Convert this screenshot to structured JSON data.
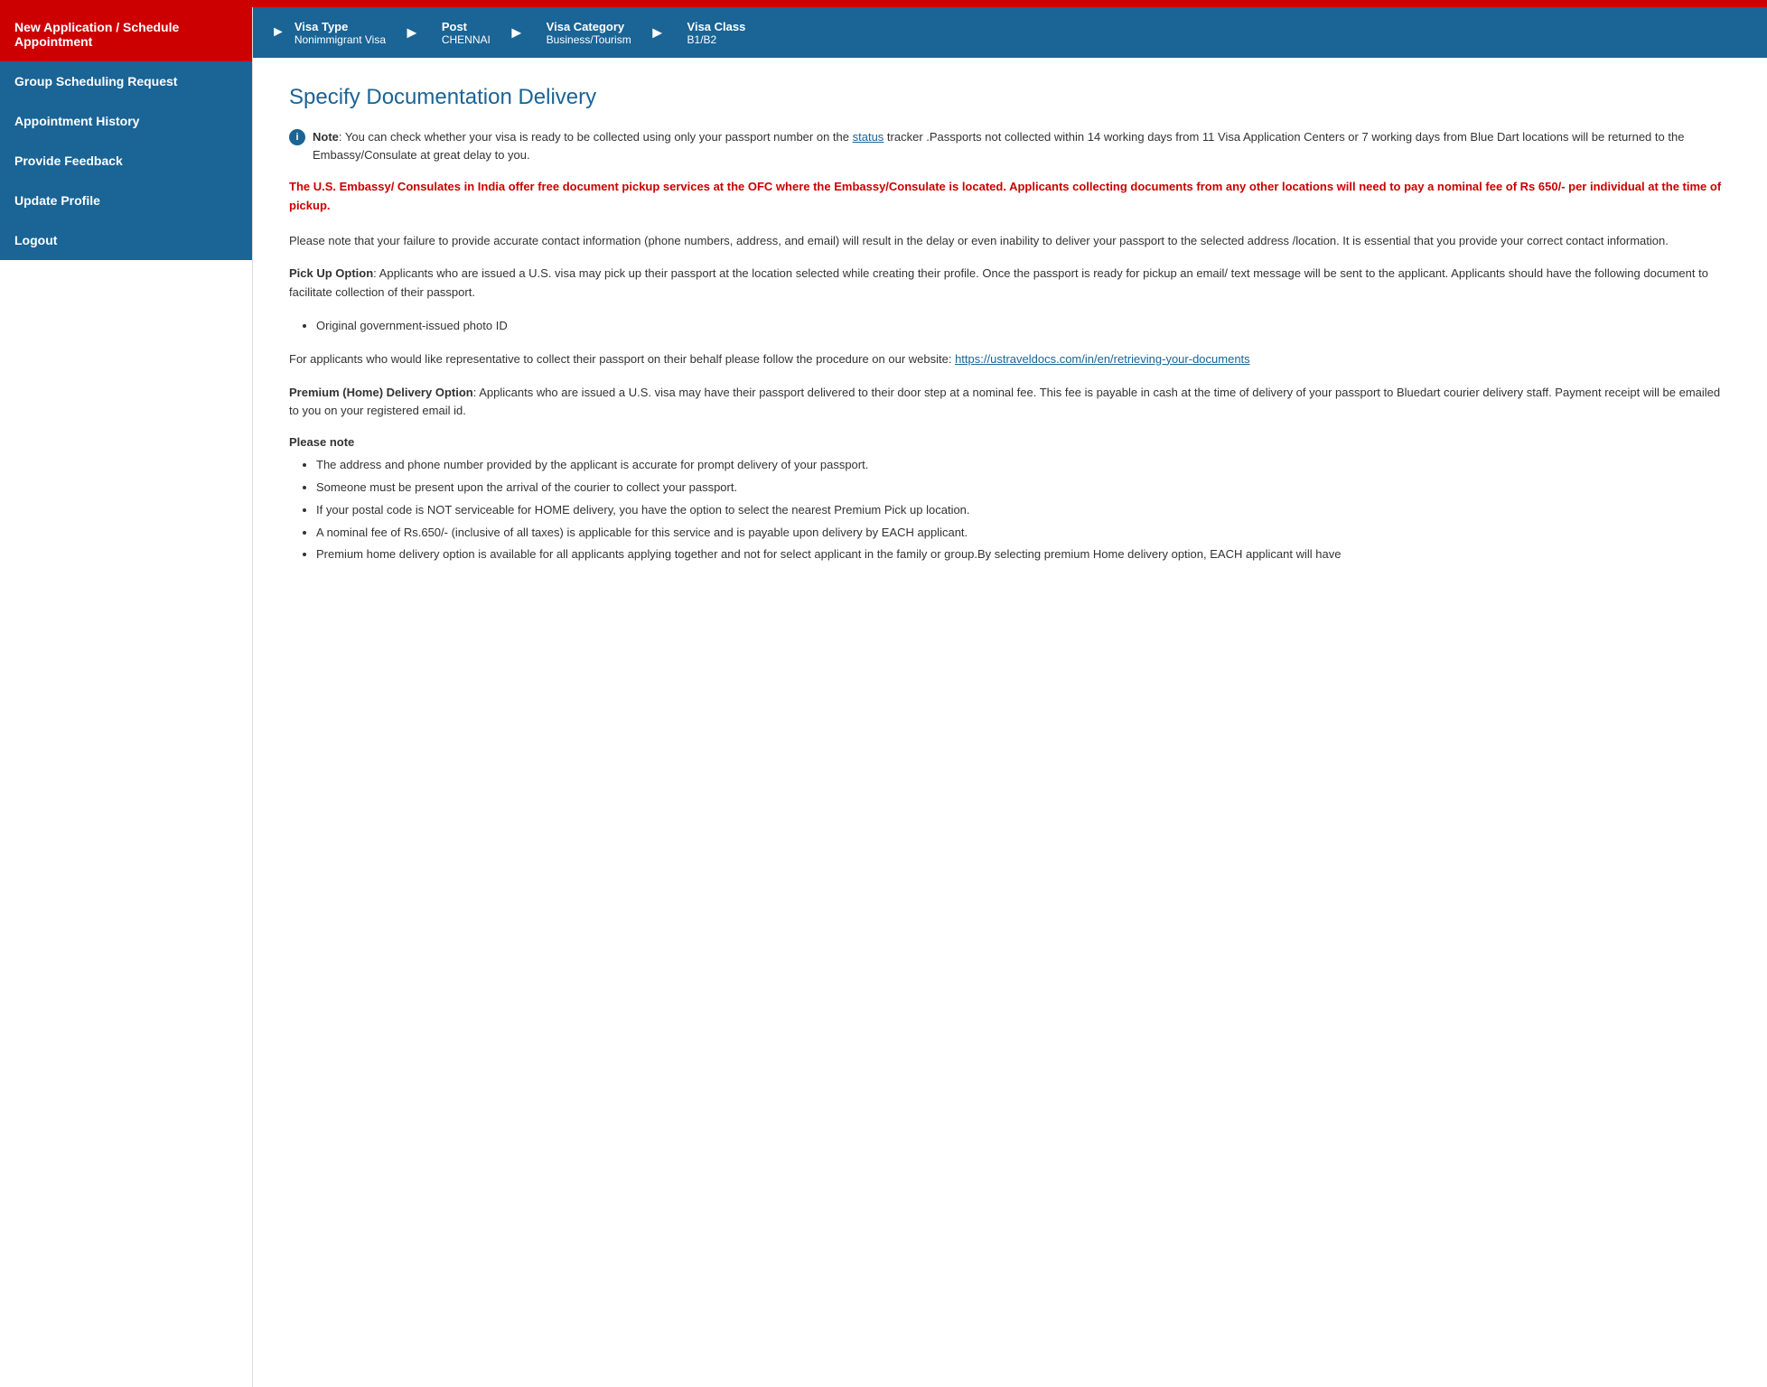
{
  "topbar": {
    "color": "#cc0000"
  },
  "sidebar": {
    "items": [
      {
        "id": "new-application",
        "label": "New Application / Schedule Appointment",
        "state": "active"
      },
      {
        "id": "group-scheduling",
        "label": "Group Scheduling Request",
        "state": "secondary"
      },
      {
        "id": "appointment-history",
        "label": "Appointment History",
        "state": "secondary"
      },
      {
        "id": "provide-feedback",
        "label": "Provide Feedback",
        "state": "secondary"
      },
      {
        "id": "update-profile",
        "label": "Update Profile",
        "state": "secondary"
      },
      {
        "id": "logout",
        "label": "Logout",
        "state": "secondary"
      }
    ]
  },
  "breadcrumb": {
    "steps": [
      {
        "label": "Visa Type",
        "value": "Nonimmigrant Visa"
      },
      {
        "label": "Post",
        "value": "CHENNAI"
      },
      {
        "label": "Visa Category",
        "value": "Business/Tourism"
      },
      {
        "label": "Visa Class",
        "value": "B1/B2"
      }
    ]
  },
  "content": {
    "page_title": "Specify Documentation Delivery",
    "info_note_prefix": "Note",
    "info_note_text": ": You can check whether your visa is ready to be collected using only your passport number on the",
    "info_note_link_text": "status",
    "info_note_link_url": "#",
    "info_note_continuation": " tracker .Passports not collected within 14 working days from 11 Visa Application Centers or 7 working days from Blue Dart locations will be returned to the Embassy/Consulate at great delay to you.",
    "warning_text": "The U.S. Embassy/ Consulates in India offer free document pickup services at the OFC where the Embassy/Consulate is located. Applicants collecting documents from any other locations will need to pay a nominal fee of Rs 650/- per individual at the time of pickup.",
    "para1": "Please note that your failure to provide accurate contact information (phone numbers, address, and email) will result in the delay or even inability to deliver your passport to the selected address /location. It is essential that you provide your correct contact information.",
    "para2_label": "Pick Up Option",
    "para2_text": ": Applicants who are issued a U.S. visa may pick up their passport at the  location selected while creating their profile.  Once the passport is ready for pickup an email/ text message will be sent to the applicant. Applicants should have the following document to facilitate collection of their passport.",
    "bullet1": "Original government-issued photo ID",
    "para3_prefix": "For applicants who would like representative to collect their passport on their behalf please follow the procedure on our website: ",
    "para3_link": "https://ustraveldocs.com/in/en/retrieving-your-documents",
    "para4_label": "Premium (Home) Delivery Option",
    "para4_text": ": Applicants who are issued a U.S. visa may have their passport delivered to their door step at a nominal fee. This fee is payable in cash at the time of delivery of  your  passport to Bluedart courier delivery staff. Payment receipt will be emailed to you on your registered email id.",
    "please_note_heading": "Please note",
    "please_note_bullets": [
      "The address and phone number provided by the applicant is accurate for prompt delivery of your passport.",
      "Someone must be present upon the arrival of the courier to collect your passport.",
      "If your postal code is NOT serviceable for HOME delivery, you have the option to select the nearest Premium Pick up location.",
      "A nominal fee of Rs.650/- (inclusive of all taxes) is applicable for this service and is payable upon delivery by EACH applicant.",
      "Premium home delivery option is available for all applicants applying together and not for select applicant in the family or group.By selecting premium Home delivery option, EACH applicant will have"
    ]
  }
}
